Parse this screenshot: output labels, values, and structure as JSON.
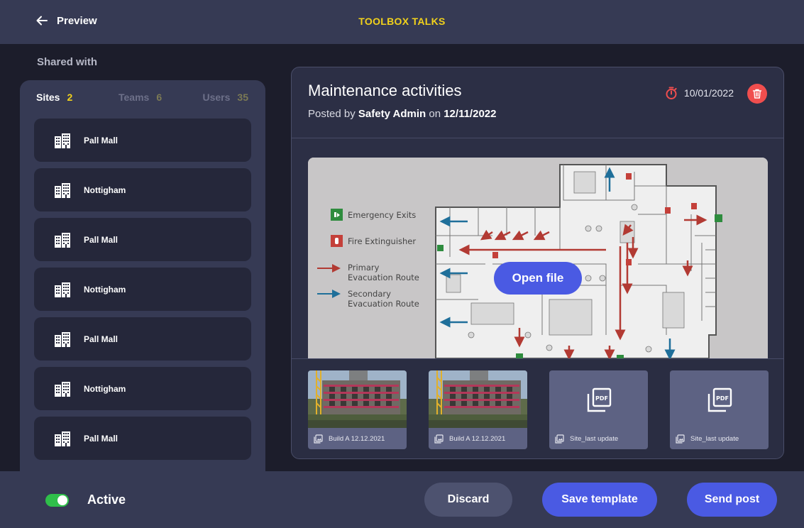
{
  "header": {
    "back_label": "Preview",
    "app_title": "TOOLBOX TALKS"
  },
  "shared_with": {
    "label": "Shared with",
    "tabs": [
      {
        "label": "Sites",
        "count": "2"
      },
      {
        "label": "Teams",
        "count": "6"
      },
      {
        "label": "Users",
        "count": "35"
      }
    ],
    "sites": [
      {
        "name": "Pall Mall"
      },
      {
        "name": "Nottigham"
      },
      {
        "name": "Pall Mall"
      },
      {
        "name": "Nottigham"
      },
      {
        "name": "Pall Mall"
      },
      {
        "name": "Nottigham"
      },
      {
        "name": "Pall Mall"
      }
    ]
  },
  "post": {
    "title": "Maintenance activities",
    "posted_prefix": "Posted by",
    "author": "Safety Admin",
    "on_word": "on",
    "posted_date": "12/11/2022",
    "due_date": "10/01/2022",
    "open_file_label": "Open file",
    "legend": {
      "emergency_exits": "Emergency Exits",
      "fire_extinguisher": "Fire Extinguisher",
      "primary_1": "Primary",
      "primary_2": "Evacuation Route",
      "secondary_1": "Secondary",
      "secondary_2": "Evacuation Route"
    },
    "attachments": [
      {
        "type": "image",
        "caption": "Build A 12.12.2021"
      },
      {
        "type": "image",
        "caption": "Build A 12.12.2021"
      },
      {
        "type": "pdf",
        "caption": "Site_last update"
      },
      {
        "type": "pdf",
        "caption": "Site_last update"
      }
    ]
  },
  "footer": {
    "active_label": "Active",
    "active_on": true,
    "discard_label": "Discard",
    "save_template_label": "Save template",
    "send_post_label": "Send post"
  },
  "colors": {
    "accent_blue": "#4a5ae3",
    "title_yellow": "#f2d21b",
    "toggle_green": "#2fbf4a",
    "delete_red": "#f04e4e"
  }
}
